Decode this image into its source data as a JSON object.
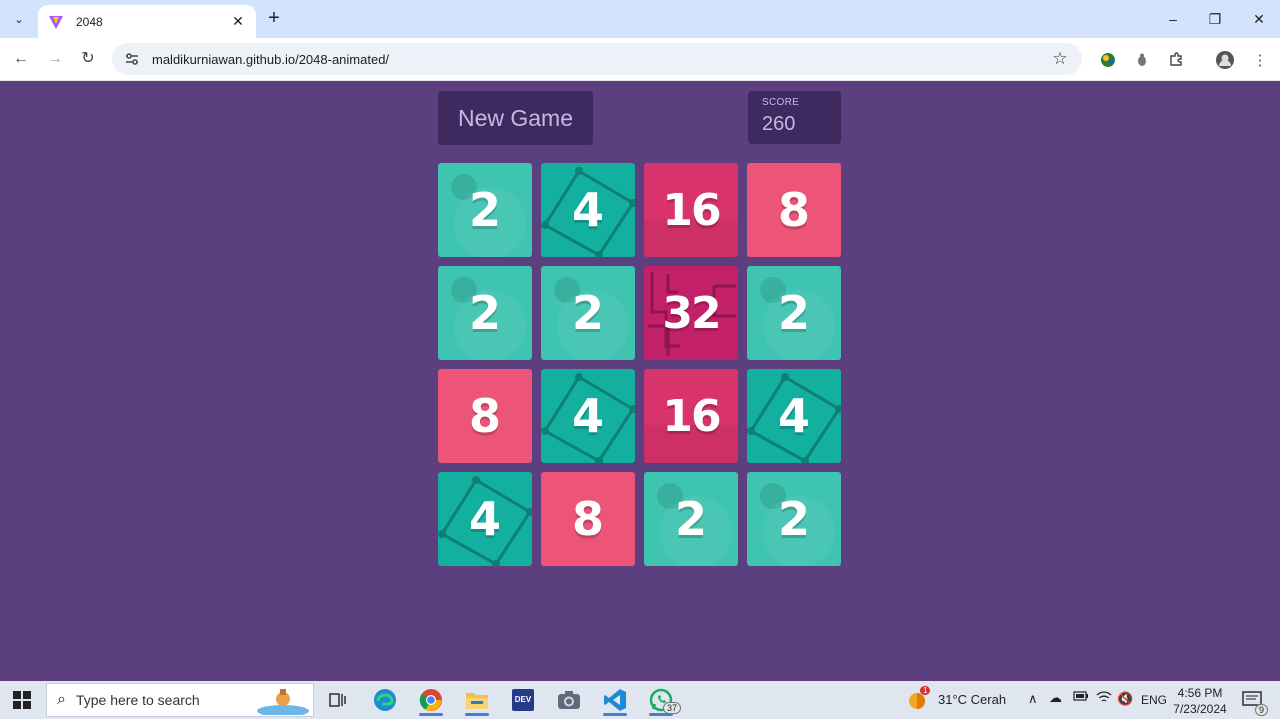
{
  "browser": {
    "tab_title": "2048",
    "url": "maldikurniawan.github.io/2048-animated/",
    "window_controls": [
      "minimize",
      "restore",
      "close"
    ]
  },
  "game": {
    "new_game_label": "New Game",
    "score_label": "SCORE",
    "score_value": "260",
    "board": [
      [
        "2",
        "4",
        "16",
        "8"
      ],
      [
        "2",
        "2",
        "32",
        "2"
      ],
      [
        "8",
        "4",
        "16",
        "4"
      ],
      [
        "4",
        "8",
        "2",
        "2"
      ]
    ],
    "tile_colors": {
      "2": "#3ec4b0",
      "4": "#13b0a0",
      "8": "#ec5577",
      "16": "#d9336b",
      "32": "#c22069"
    },
    "background_color": "#5b3f7e",
    "panel_color": "#3f2a5f"
  },
  "taskbar": {
    "search_placeholder": "Type here to search",
    "whatsapp_badge": "37",
    "weather_badge": "1",
    "weather": "31°C  Cerah",
    "language": "ENG",
    "time": "4:56 PM",
    "date": "7/23/2024",
    "notifications_badge": "9",
    "apps": [
      "task-view-icon",
      "edge-icon",
      "chrome-icon",
      "file-explorer-icon",
      "dev-icon",
      "camera-icon",
      "vscode-icon",
      "whatsapp-icon"
    ]
  }
}
